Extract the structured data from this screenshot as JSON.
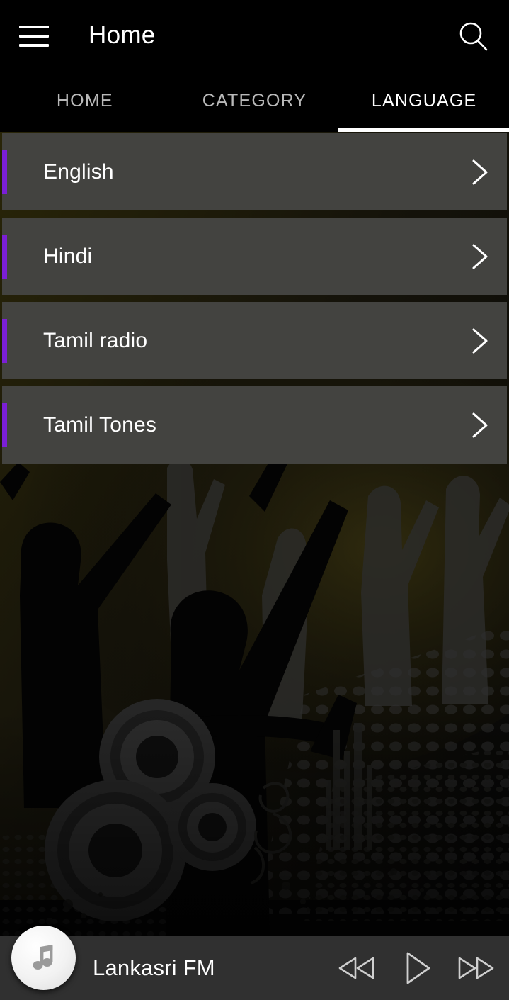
{
  "appbar": {
    "title": "Home",
    "menu_icon": "hamburger-menu-icon",
    "search_icon": "search-icon"
  },
  "tabs": {
    "items": [
      {
        "label": "HOME",
        "active": false
      },
      {
        "label": "CATEGORY",
        "active": false
      },
      {
        "label": "LANGUAGE",
        "active": true
      }
    ],
    "active_index": 2,
    "indicator_color": "#FFFFFF",
    "inactive_color": "#B9B9B9",
    "active_color": "#FFFFFF"
  },
  "language_list": {
    "items": [
      {
        "label": "English",
        "chevron_icon": "chevron-right-icon"
      },
      {
        "label": "Hindi",
        "chevron_icon": "chevron-right-icon"
      },
      {
        "label": "Tamil radio",
        "chevron_icon": "chevron-right-icon"
      },
      {
        "label": "Tamil Tones",
        "chevron_icon": "chevron-right-icon"
      }
    ],
    "card_color": "#434340",
    "accent_color": "#7B1FD6",
    "label_color": "#FFFFFF"
  },
  "player": {
    "track_title": "Lankasri FM",
    "album_art_icon": "music-note-icon",
    "bar_color": "#303030",
    "controls": [
      {
        "name": "rewind-button",
        "icon": "rewind-icon",
        "label": "Rewind"
      },
      {
        "name": "play-button",
        "icon": "play-icon",
        "label": "Play"
      },
      {
        "name": "fast-forward-button",
        "icon": "fast-forward-icon",
        "label": "Fast forward"
      }
    ]
  },
  "background": {
    "description": "dark concert crowd silhouettes with speaker cones and halftone dots",
    "tint_color": "#1C1A08"
  }
}
